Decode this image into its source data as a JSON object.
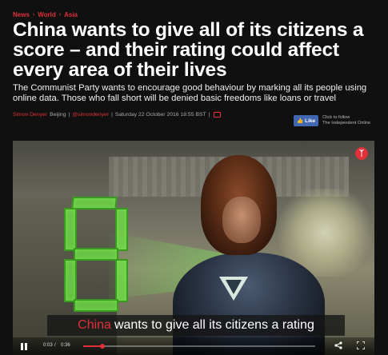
{
  "breadcrumb": {
    "items": [
      "News",
      "World",
      "Asia"
    ],
    "separator": "›"
  },
  "article": {
    "headline": "China wants to give all of its citizens a score – and their rating could affect every area of their lives",
    "standfirst": "The Communist Party wants to encourage good behaviour by marking all its people using online data. Those who fall short will be denied basic freedoms like loans or travel",
    "author": "Simon Denyer",
    "location": "Beijing",
    "twitter": "@simondenyer",
    "date": "Saturday 22 October 2016 18:55 BST",
    "divider": "|"
  },
  "follow": {
    "like_label": "Like",
    "follow_text_line1": "Click to follow",
    "follow_text_line2": "The Independent Online"
  },
  "video": {
    "subtitle_highlight": "China",
    "subtitle_rest": "wants to give all its citizens a rating",
    "current_time": "0:03",
    "time_separator": "/",
    "duration": "0:36",
    "progress": 0.083,
    "icons": {
      "play_state": "pause-icon",
      "share": "share-icon",
      "fullscreen": "fullscreen-icon",
      "brand": "independent-eagle-icon"
    },
    "scene_digit": "8"
  },
  "colors": {
    "accent": "#e0313a",
    "facebook": "#4267b2",
    "background": "#101010"
  }
}
